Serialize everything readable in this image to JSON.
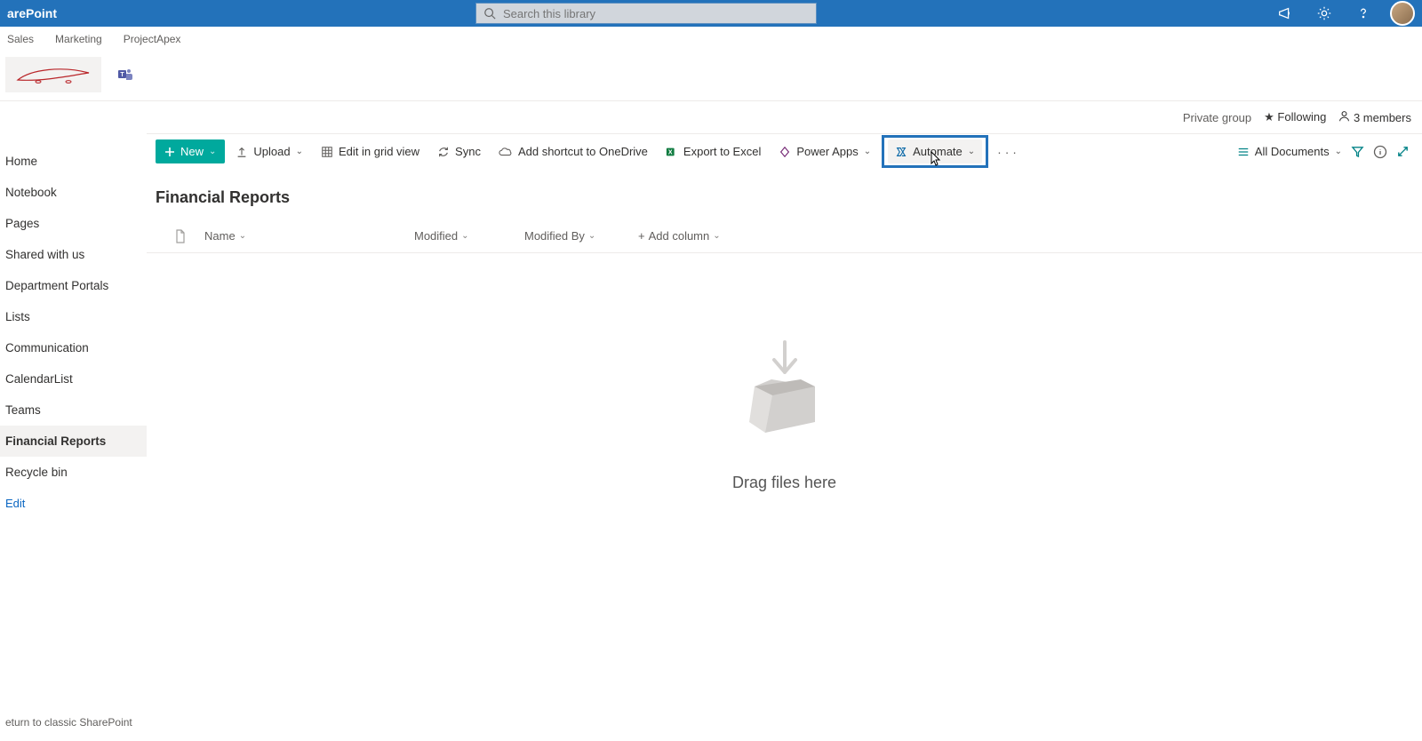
{
  "suite": {
    "app_name": "arePoint",
    "search_placeholder": "Search this library"
  },
  "hub_nav": [
    "Sales",
    "Marketing",
    "ProjectApex"
  ],
  "group_info": {
    "privacy": "Private group",
    "following": "Following",
    "members": "3 members"
  },
  "left_nav": {
    "items": [
      {
        "label": "Home",
        "active": false
      },
      {
        "label": "Notebook",
        "active": false
      },
      {
        "label": "Pages",
        "active": false
      },
      {
        "label": "Shared with us",
        "active": false
      },
      {
        "label": "Department Portals",
        "active": false
      },
      {
        "label": "Lists",
        "active": false
      },
      {
        "label": "Communication",
        "active": false
      },
      {
        "label": "CalendarList",
        "active": false
      },
      {
        "label": "Teams",
        "active": false
      },
      {
        "label": "Financial Reports",
        "active": true
      },
      {
        "label": "Recycle bin",
        "active": false
      }
    ],
    "edit": "Edit",
    "return": "eturn to classic SharePoint"
  },
  "commands": {
    "new": "New",
    "upload": "Upload",
    "edit_grid": "Edit in grid view",
    "sync": "Sync",
    "shortcut": "Add shortcut to OneDrive",
    "export": "Export to Excel",
    "power_apps": "Power Apps",
    "automate": "Automate",
    "view_label": "All Documents"
  },
  "library": {
    "title": "Financial Reports",
    "columns": {
      "name": "Name",
      "modified": "Modified",
      "modified_by": "Modified By",
      "add": "Add column"
    },
    "empty_text": "Drag files here"
  }
}
